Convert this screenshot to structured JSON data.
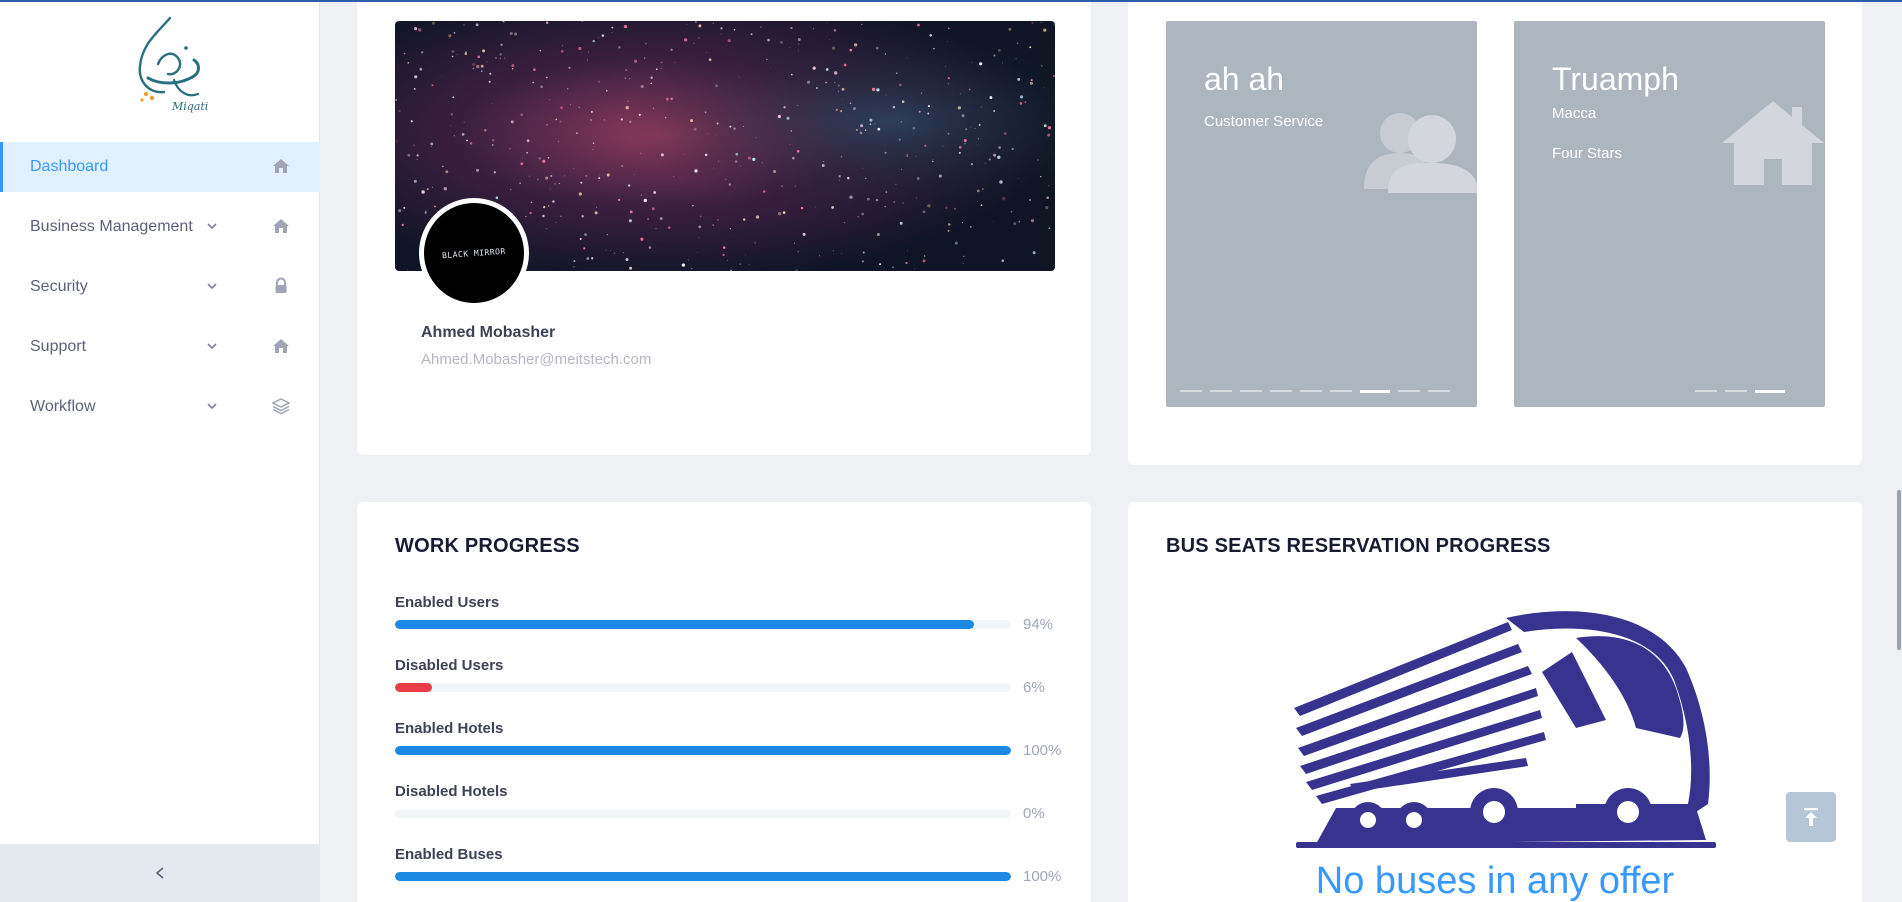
{
  "sidebar": {
    "logo": {
      "name": "miqati-logo",
      "text": "Miqati"
    },
    "items": [
      {
        "label": "Dashboard",
        "icon": "home-icon",
        "active": true,
        "has_chevron": false
      },
      {
        "label": "Business Management",
        "icon": "home-icon",
        "active": false,
        "has_chevron": true
      },
      {
        "label": "Security",
        "icon": "lock-icon",
        "active": false,
        "has_chevron": true
      },
      {
        "label": "Support",
        "icon": "home-icon",
        "active": false,
        "has_chevron": true
      },
      {
        "label": "Workflow",
        "icon": "layers-icon",
        "active": false,
        "has_chevron": true
      }
    ],
    "collapse_icon": "chevron-left-icon"
  },
  "profile": {
    "name": "Ahmed Mobasher",
    "email": "Ahmed.Mobasher@meitstech.com",
    "avatar_text": "BLACK MIRROR"
  },
  "slides": [
    {
      "title": "ah ah",
      "lines": [
        "Customer Service"
      ],
      "icon": "users-icon",
      "dot_count": 9,
      "active_dot": 6
    },
    {
      "title": "Truamph",
      "lines": [
        "Macca",
        "Four Stars"
      ],
      "icon": "house-icon",
      "dot_count": 3,
      "active_dot": 2
    }
  ],
  "work_progress": {
    "title": "WORK PROGRESS",
    "items": [
      {
        "label": "Enabled Users",
        "value_text": "94%",
        "value": 94,
        "color": "#1e88e5"
      },
      {
        "label": "Disabled Users",
        "value_text": "6%",
        "value": 6,
        "color": "#e63d47"
      },
      {
        "label": "Enabled Hotels",
        "value_text": "100%",
        "value": 100,
        "color": "#1e88e5"
      },
      {
        "label": "Disabled Hotels",
        "value_text": "0%",
        "value": 0,
        "color": "#e63d47"
      },
      {
        "label": "Enabled Buses",
        "value_text": "100%",
        "value": 100,
        "color": "#1e88e5"
      }
    ]
  },
  "bus_progress": {
    "title": "BUS SEATS RESERVATION PROGRESS",
    "message": "No buses in any offer",
    "bus_color": "#37338f"
  },
  "scroll_top_icon": "arrow-up-to-top-icon",
  "colors": {
    "primary": "#3699ff",
    "active_bg": "#e1f0ff",
    "page_bg": "#eef0f4",
    "slide_bg": "#adb5bf"
  }
}
